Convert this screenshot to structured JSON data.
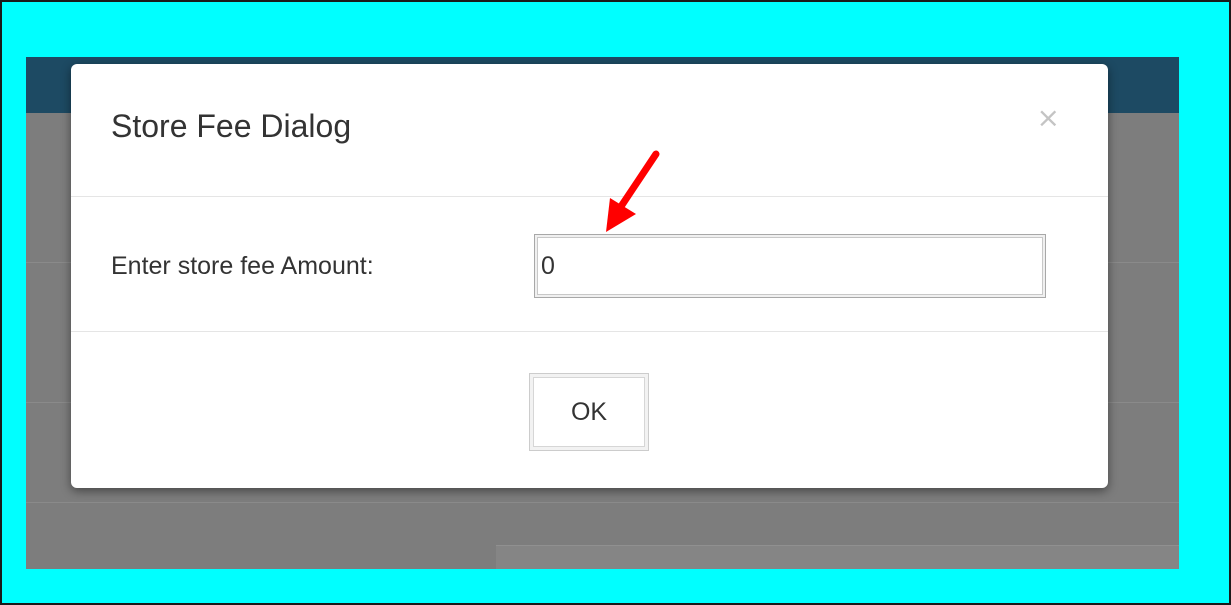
{
  "dialog": {
    "title": "Store Fee Dialog",
    "close_label": "×",
    "field_label": "Enter store fee Amount:",
    "amount_value": "0",
    "ok_label": "OK"
  },
  "annotation": {
    "arrow_color": "#ff0000"
  },
  "colors": {
    "border_frame": "#00ffff",
    "app_topbar": "#1d4a63",
    "backdrop": "#7d7d7d"
  }
}
